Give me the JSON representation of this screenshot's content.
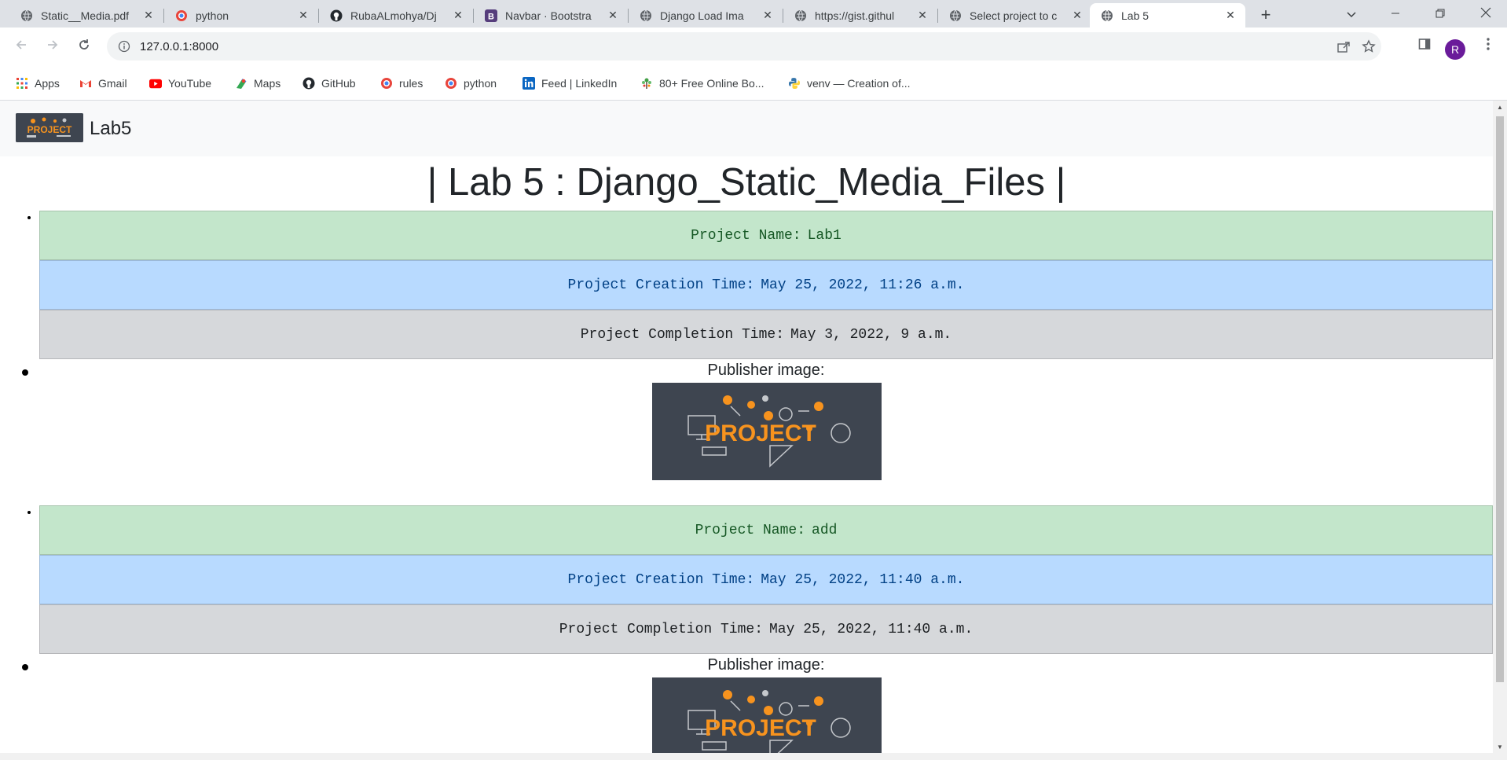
{
  "browser": {
    "tabs": [
      {
        "title": "Static__Media.pdf",
        "icon": "globe-icon",
        "active": false
      },
      {
        "title": "python",
        "icon": "search-engine-icon",
        "active": false
      },
      {
        "title": "RubaALmohya/Dj",
        "icon": "github-icon",
        "active": false
      },
      {
        "title": "Navbar · Bootstra",
        "icon": "bootstrap-icon",
        "active": false
      },
      {
        "title": "Django Load Ima",
        "icon": "globe-icon",
        "active": false
      },
      {
        "title": "https://gist.githul",
        "icon": "globe-icon",
        "active": false
      },
      {
        "title": "Select project to c",
        "icon": "globe-icon",
        "active": false
      },
      {
        "title": "Lab 5",
        "icon": "globe-icon",
        "active": true
      }
    ],
    "url": "127.0.0.1:8000",
    "profile_initial": "R",
    "bookmarks": [
      {
        "label": "Apps",
        "icon": "apps-grid-icon"
      },
      {
        "label": "Gmail",
        "icon": "gmail-icon"
      },
      {
        "label": "YouTube",
        "icon": "youtube-icon"
      },
      {
        "label": "Maps",
        "icon": "maps-icon"
      },
      {
        "label": "GitHub",
        "icon": "github-icon"
      },
      {
        "label": "rules",
        "icon": "search-engine-icon"
      },
      {
        "label": "python",
        "icon": "search-engine-icon"
      },
      {
        "label": "Feed | LinkedIn",
        "icon": "linkedin-icon"
      },
      {
        "label": "80+ Free Online Bo...",
        "icon": "tree-icon"
      },
      {
        "label": "venv — Creation of...",
        "icon": "python-icon"
      }
    ]
  },
  "page": {
    "brand": "Lab5",
    "heading": "| Lab 5 : Django_Static_Media_Files |",
    "projects": [
      {
        "name_label": "Project Name:",
        "name": "Lab1",
        "creation_label": "Project Creation Time:",
        "creation": "May 25, 2022, 11:26 a.m.",
        "completion_label": "Project Completion Time:",
        "completion": "May 3, 2022, 9 a.m.",
        "publisher_label": "Publisher image:",
        "image_text": "PROJECT"
      },
      {
        "name_label": "Project Name:",
        "name": "add",
        "creation_label": "Project Creation Time:",
        "creation": "May 25, 2022, 11:40 a.m.",
        "completion_label": "Project Completion Time:",
        "completion": "May 25, 2022, 11:40 a.m.",
        "publisher_label": "Publisher image:",
        "image_text": "PROJECT"
      }
    ]
  },
  "colors": {
    "success_bg": "#c3e6cb",
    "primary_bg": "#b8daff",
    "secondary_bg": "#d6d8db",
    "logo_bg": "#3e4550",
    "logo_orange": "#f7931e",
    "profile": "#6a1b9a"
  }
}
